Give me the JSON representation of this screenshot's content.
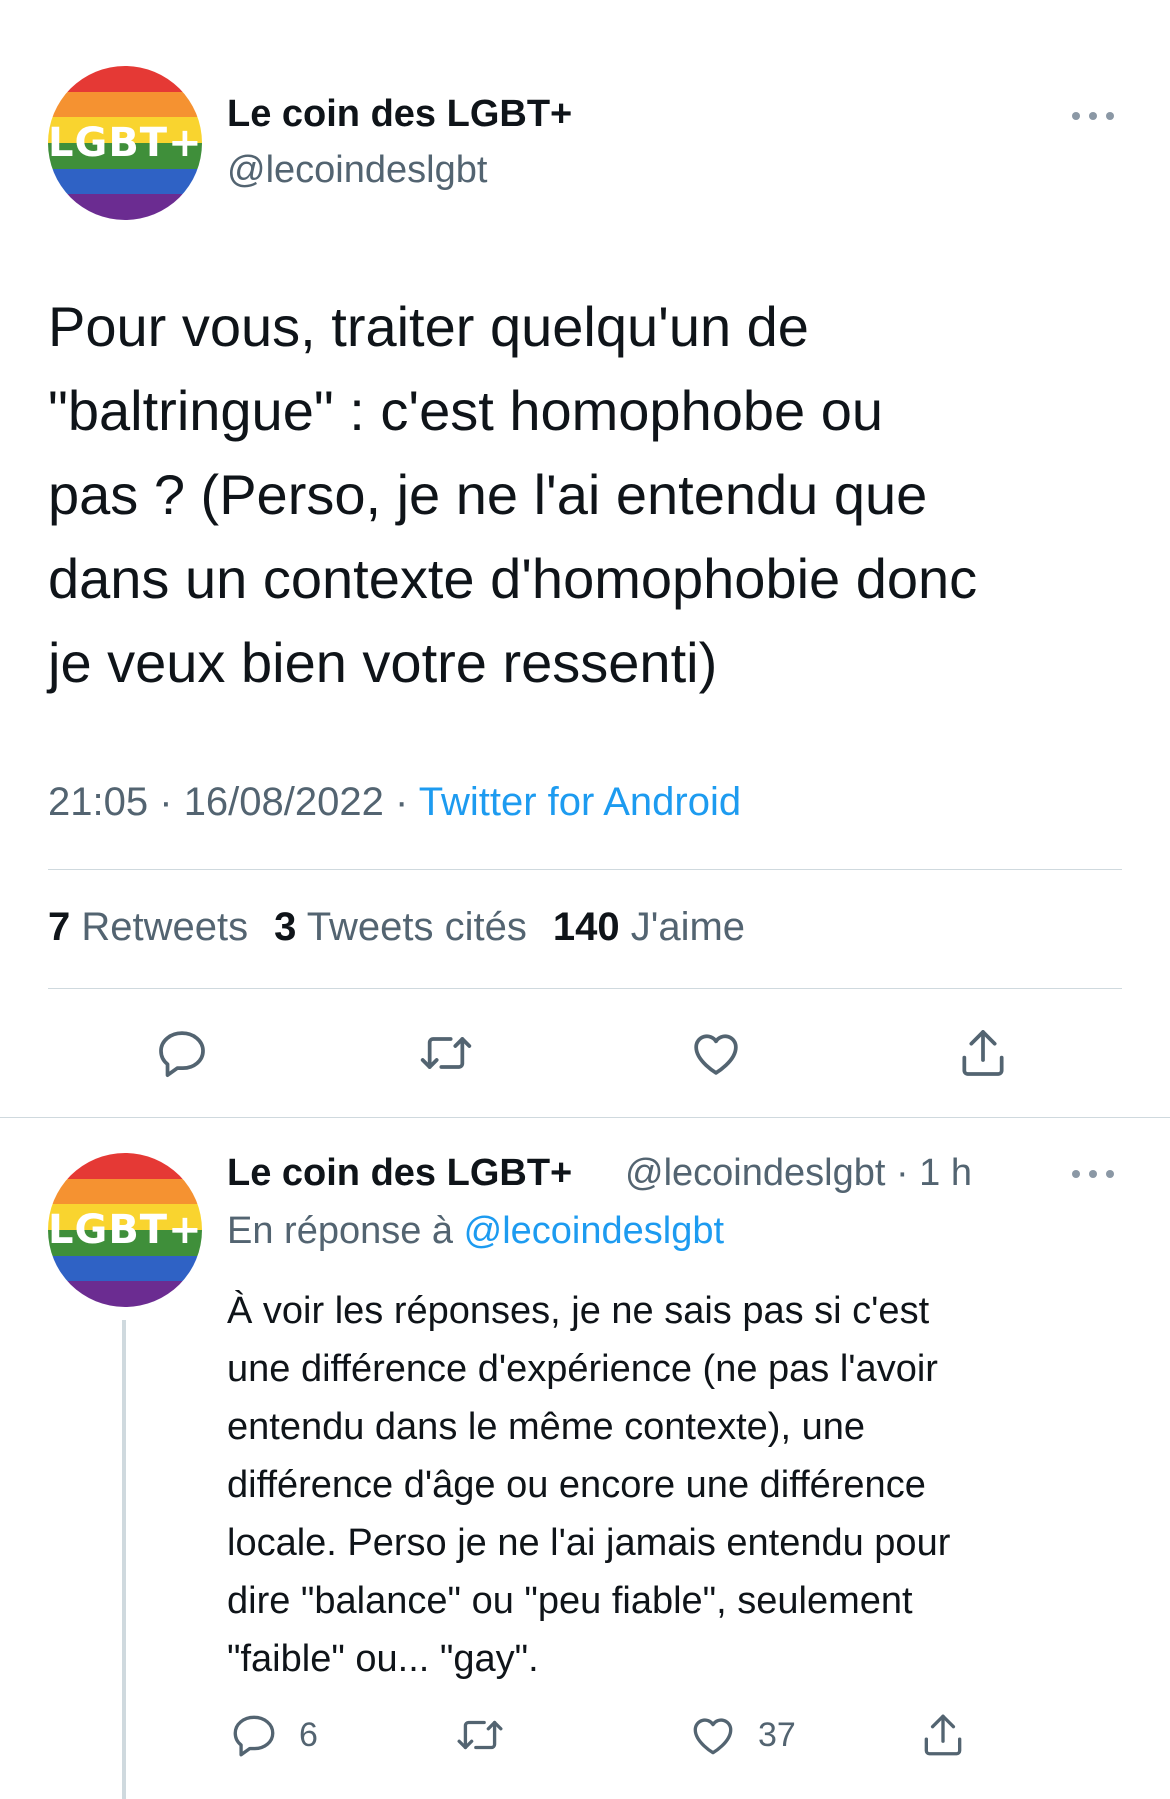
{
  "colors": {
    "text": "#0f1419",
    "secondary": "#536471",
    "link": "#1d9bf0",
    "divider": "#cfd9de",
    "rainbow": [
      "#e53935",
      "#f59231",
      "#f9d42f",
      "#3f8f3a",
      "#2f62c5",
      "#6b2c91"
    ]
  },
  "main_tweet": {
    "avatar": {
      "logo_text": "LGBT+",
      "icon": "rainbow-flag-avatar"
    },
    "author_name": "Le coin des LGBT+",
    "author_handle": "@lecoindeslgbt",
    "text": "Pour vous, traiter quelqu'un de\n\"baltringue\" : c'est homophobe ou\npas ? (Perso, je ne l'ai entendu que\ndans un contexte d'homophobie donc\nje veux bien votre ressenti)",
    "time": "21:05",
    "separator": "·",
    "date": "16/08/2022",
    "source": "Twitter for Android",
    "stats": {
      "retweets_count": "7",
      "retweets_label": "Retweets",
      "quotes_count": "3",
      "quotes_label": "Tweets cités",
      "likes_count": "140",
      "likes_label": "J'aime"
    },
    "actions": [
      "reply-icon",
      "retweet-icon",
      "like-icon",
      "share-icon"
    ]
  },
  "reply_tweet": {
    "avatar": {
      "logo_text": "LGBT+",
      "icon": "rainbow-flag-avatar"
    },
    "author_name": "Le coin des LGBT+",
    "handle_time": "@lecoindeslgbt · 1 h",
    "replying_prefix": "En réponse à",
    "replying_to": "@lecoindeslgbt",
    "text": "À voir les réponses, je ne sais pas si c'est\nune différence d'expérience (ne pas l'avoir\nentendu dans le même contexte), une\ndifférence d'âge ou encore une différence\nlocale. Perso je ne l'ai jamais entendu pour\ndire \"balance\" ou \"peu fiable\", seulement\n\"faible\" ou... \"gay\".",
    "reply_count": "6",
    "like_count": "37"
  }
}
